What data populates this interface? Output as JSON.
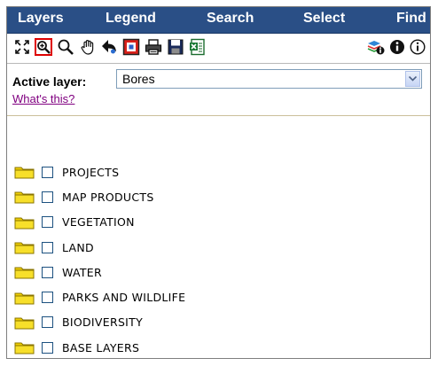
{
  "tabs": [
    {
      "label": "Layers"
    },
    {
      "label": "Legend"
    },
    {
      "label": "Search"
    },
    {
      "label": "Select"
    },
    {
      "label": "Find"
    }
  ],
  "toolbar": {
    "icons": [
      "full-extent-icon",
      "zoom-in-box-icon",
      "zoom-icon",
      "pan-hand-icon",
      "back-arrow-icon",
      "red-square-icon",
      "print-icon",
      "save-disk-icon",
      "excel-export-icon",
      "layer-info-icon",
      "info-icon",
      "info-outline-icon"
    ]
  },
  "active_layer": {
    "label": "Active layer:",
    "value": "Bores"
  },
  "help_link": "What's this?",
  "tree": [
    {
      "label": "PROJECTS"
    },
    {
      "label": "MAP PRODUCTS"
    },
    {
      "label": "VEGETATION"
    },
    {
      "label": "LAND"
    },
    {
      "label": "WATER"
    },
    {
      "label": "PARKS AND WILDLIFE"
    },
    {
      "label": "BIODIVERSITY"
    },
    {
      "label": "BASE LAYERS"
    }
  ],
  "colors": {
    "tab_bar": "#2a4f86",
    "folder": "#f0d000",
    "link_visited": "#800080"
  }
}
